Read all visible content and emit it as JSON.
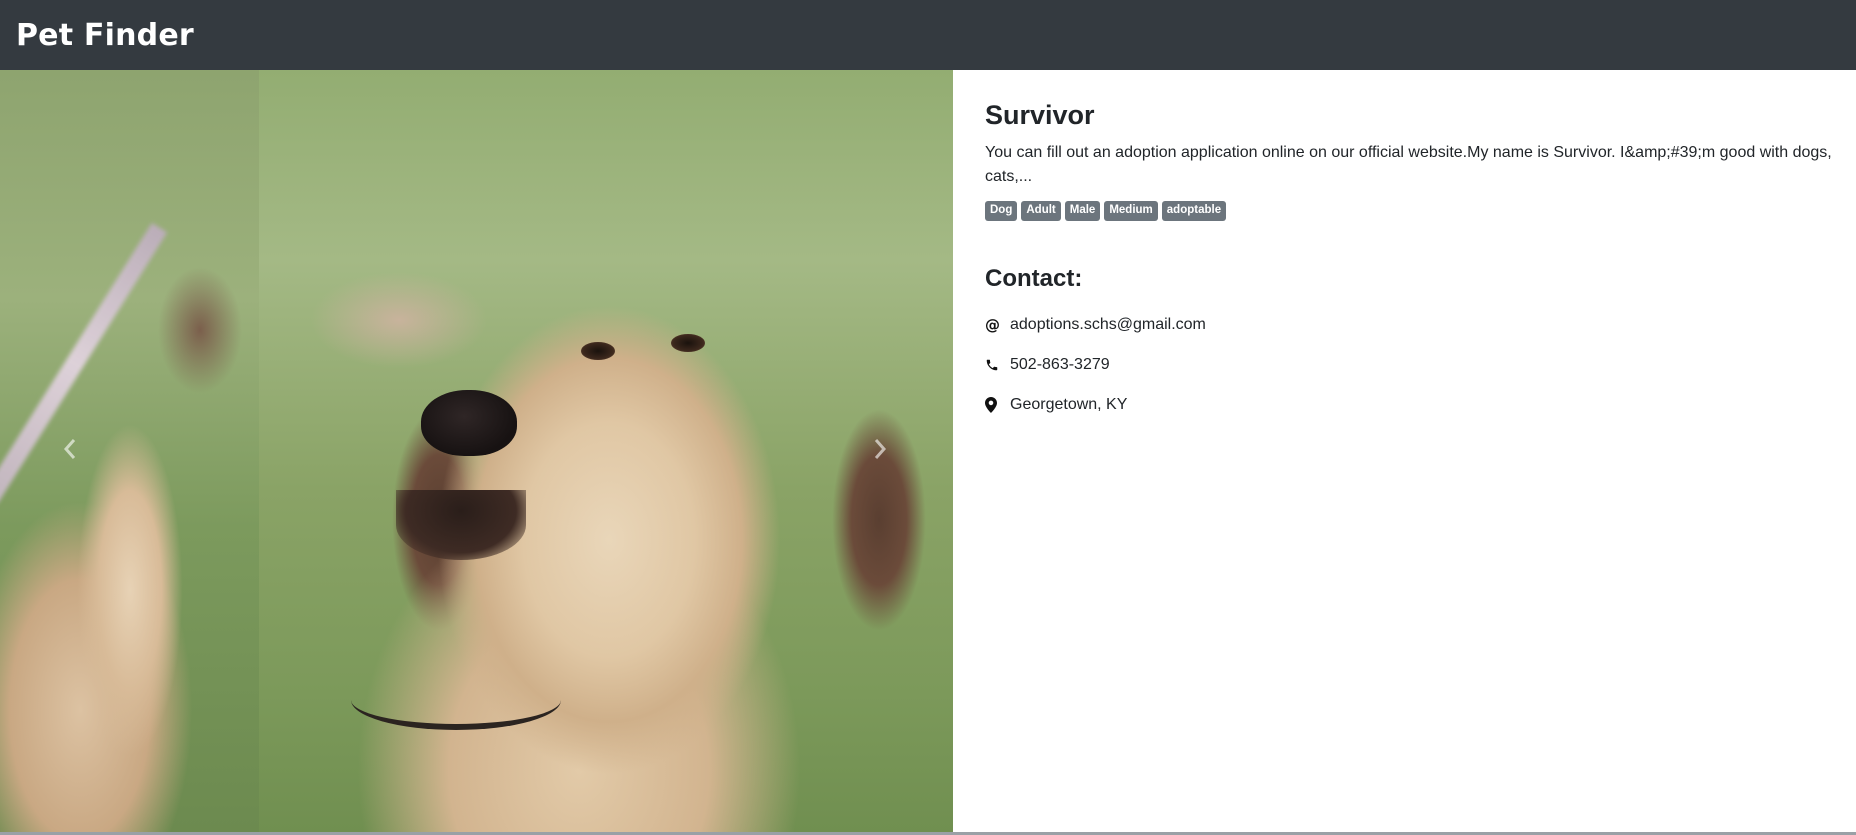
{
  "navbar": {
    "brand": "Pet Finder"
  },
  "gallery": {
    "prev_icon": "chevron-left-icon",
    "next_icon": "chevron-right-icon"
  },
  "pet": {
    "name": "Survivor",
    "description": "You can fill out an adoption application online on our official website.My name is Survivor. I&amp;#39;m good with dogs, cats,...",
    "badges": [
      "Dog",
      "Adult",
      "Male",
      "Medium",
      "adoptable"
    ]
  },
  "contact": {
    "title": "Contact:",
    "email": "adoptions.schs@gmail.com",
    "phone": "502-863-3279",
    "location": "Georgetown, KY",
    "email_icon": "at-icon",
    "phone_icon": "phone-icon",
    "location_icon": "map-pin-icon"
  },
  "colors": {
    "navbar_bg": "#343a40",
    "badge_bg": "#6c757d"
  }
}
